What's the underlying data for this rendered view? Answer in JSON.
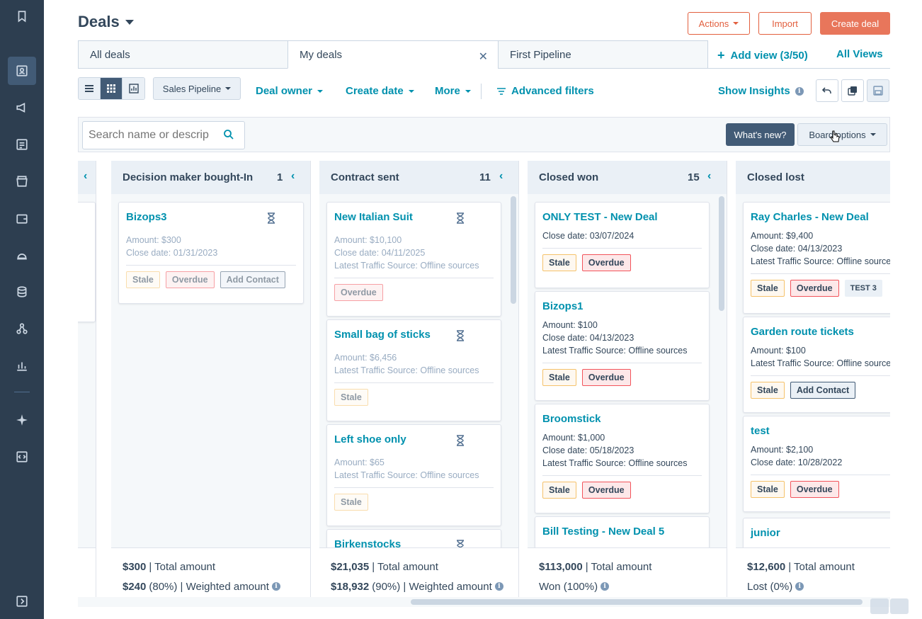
{
  "header": {
    "title": "Deals",
    "actions_label": "Actions",
    "import_label": "Import",
    "create_label": "Create deal"
  },
  "tabs": [
    {
      "label": "All deals"
    },
    {
      "label": "My deals"
    },
    {
      "label": "First Pipeline"
    }
  ],
  "add_view_label": "Add view (3/50)",
  "all_views_label": "All Views",
  "toolbar": {
    "pipeline_label": "Sales Pipeline",
    "filters": [
      "Deal owner",
      "Create date",
      "More"
    ],
    "advanced_filters_label": "Advanced filters",
    "show_insights_label": "Show Insights"
  },
  "search": {
    "placeholder": "Search name or descrip",
    "whats_new_label": "What's new?",
    "board_options_label": "Board options"
  },
  "columns": [
    {
      "name": "Decision maker bought-In",
      "count": "1",
      "cards": [
        {
          "name": "Bizops3",
          "lines": [
            "Amount: $300",
            "Close date: 01/31/2023"
          ],
          "tags": [
            "Stale",
            "Overdue",
            "Add Contact"
          ]
        }
      ],
      "total_amount": "$300",
      "total_label": "| Total amount",
      "second_value": "$240",
      "second_label": "(80%) | Weighted amount"
    },
    {
      "name": "Contract sent",
      "count": "11",
      "cards": [
        {
          "name": "New Italian Suit",
          "lines": [
            "Amount: $10,100",
            "Close date: 04/11/2025",
            "Latest Traffic Source: Offline sources"
          ],
          "tags": [
            "Overdue"
          ]
        },
        {
          "name": "Small bag of sticks",
          "lines": [
            "Amount: $6,456",
            "Latest Traffic Source: Offline sources"
          ],
          "tags": [
            "Stale"
          ]
        },
        {
          "name": "Left shoe only",
          "lines": [
            "Amount: $65",
            "Latest Traffic Source: Offline sources"
          ],
          "tags": [
            "Stale"
          ]
        },
        {
          "name": "Birkenstocks",
          "lines": [],
          "tags": []
        }
      ],
      "total_amount": "$21,035",
      "total_label": "| Total amount",
      "second_value": "$18,932",
      "second_label": "(90%) | Weighted amount"
    },
    {
      "name": "Closed won",
      "count": "15",
      "cards": [
        {
          "name": "ONLY TEST - New Deal",
          "lines": [
            "Close date: 03/07/2024"
          ],
          "tags": [
            "Stale",
            "Overdue"
          ]
        },
        {
          "name": "Bizops1",
          "lines": [
            "Amount: $100",
            "Close date: 04/13/2023",
            "Latest Traffic Source: Offline sources"
          ],
          "tags": [
            "Stale",
            "Overdue"
          ]
        },
        {
          "name": "Broomstick",
          "lines": [
            "Amount: $1,000",
            "Close date: 05/18/2023",
            "Latest Traffic Source: Offline sources"
          ],
          "tags": [
            "Stale",
            "Overdue"
          ]
        },
        {
          "name": "Bill Testing - New Deal 5",
          "lines": [],
          "tags": []
        }
      ],
      "total_amount": "$113,000",
      "total_label": "| Total amount",
      "second_value": "",
      "second_label": "Won (100%)"
    },
    {
      "name": "Closed lost",
      "count": "",
      "cards": [
        {
          "name": "Ray Charles - New Deal",
          "lines": [
            "Amount: $9,400",
            "Close date: 04/13/2023",
            "Latest Traffic Source: Offline sources"
          ],
          "tags": [
            "Stale",
            "Overdue",
            "TEST 3"
          ]
        },
        {
          "name": "Garden route tickets",
          "lines": [
            "Amount: $100",
            "Latest Traffic Source: Offline sources"
          ],
          "tags": [
            "Stale",
            "Add Contact"
          ]
        },
        {
          "name": "test",
          "lines": [
            "Amount: $2,100",
            "Close date: 10/28/2022"
          ],
          "tags": [
            "Stale",
            "Overdue"
          ]
        },
        {
          "name": "junior",
          "lines": [],
          "tags": []
        }
      ],
      "total_amount": "$12,600",
      "total_label": "| Total amount",
      "second_value": "",
      "second_label": "Lost (0%)"
    }
  ],
  "colors": {
    "accent": "#0091ae",
    "brand": "#ff7a59",
    "sidebar": "#2d3e50"
  }
}
